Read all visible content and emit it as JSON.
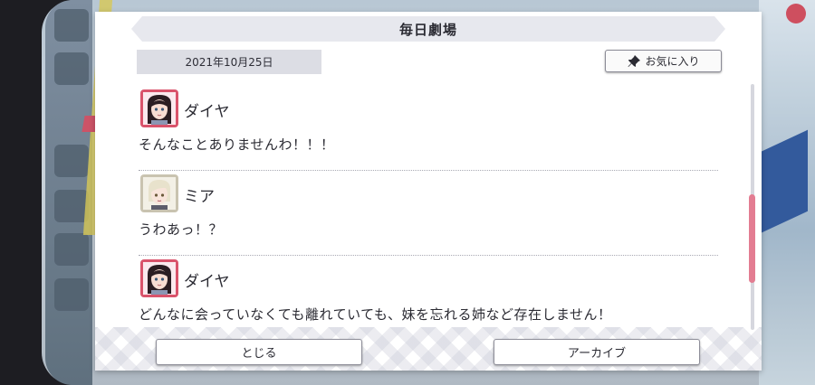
{
  "dialog": {
    "title": "毎日劇場",
    "date": "2021年10月25日",
    "favorite_label": "お気に入り",
    "favorite_icon": "pin-icon"
  },
  "messages": [
    {
      "speaker": "ダイヤ",
      "text": "そんなことありませんわ！！！",
      "avatar": "dia-avatar"
    },
    {
      "speaker": "ミア",
      "text": "うわあっ！？",
      "avatar": "mia-avatar"
    },
    {
      "speaker": "ダイヤ",
      "text": "どんなに会っていなくても離れていても、妹を忘れる姉など存在しません！",
      "avatar": "dia-avatar"
    }
  ],
  "buttons": {
    "close_label": "とじる",
    "archive_label": "アーカイブ"
  },
  "colors": {
    "scroll_thumb": "#e37d92",
    "avatar_frame_dia": "#d9536b",
    "avatar_frame_mia": "#c9c3b0"
  }
}
